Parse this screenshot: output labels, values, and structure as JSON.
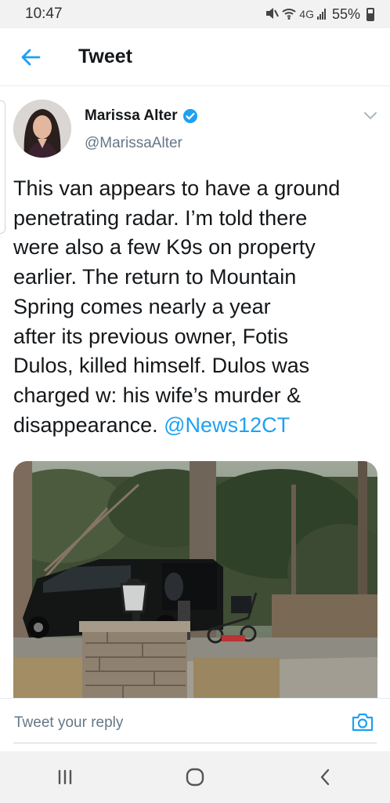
{
  "status_bar": {
    "time": "10:47",
    "network": "4G",
    "battery": "55%"
  },
  "header": {
    "title": "Tweet"
  },
  "tweet": {
    "author_name": "Marissa Alter",
    "author_handle": "@MarissaAlter",
    "text": "This van appears to have a ground\npenetrating radar. I’m told there\nwere also a few K9s on property\nearlier. The return to Mountain\nSpring comes nearly a year\nafter its previous owner, Fotis\nDulos, killed himself. Dulos was\ncharged w: his wife’s murder &\ndisappearance. ",
    "mention": "@News12CT"
  },
  "reply": {
    "placeholder": "Tweet your reply"
  },
  "colors": {
    "accent": "#1da1f2",
    "text": "#14171a",
    "secondary": "#657786"
  }
}
